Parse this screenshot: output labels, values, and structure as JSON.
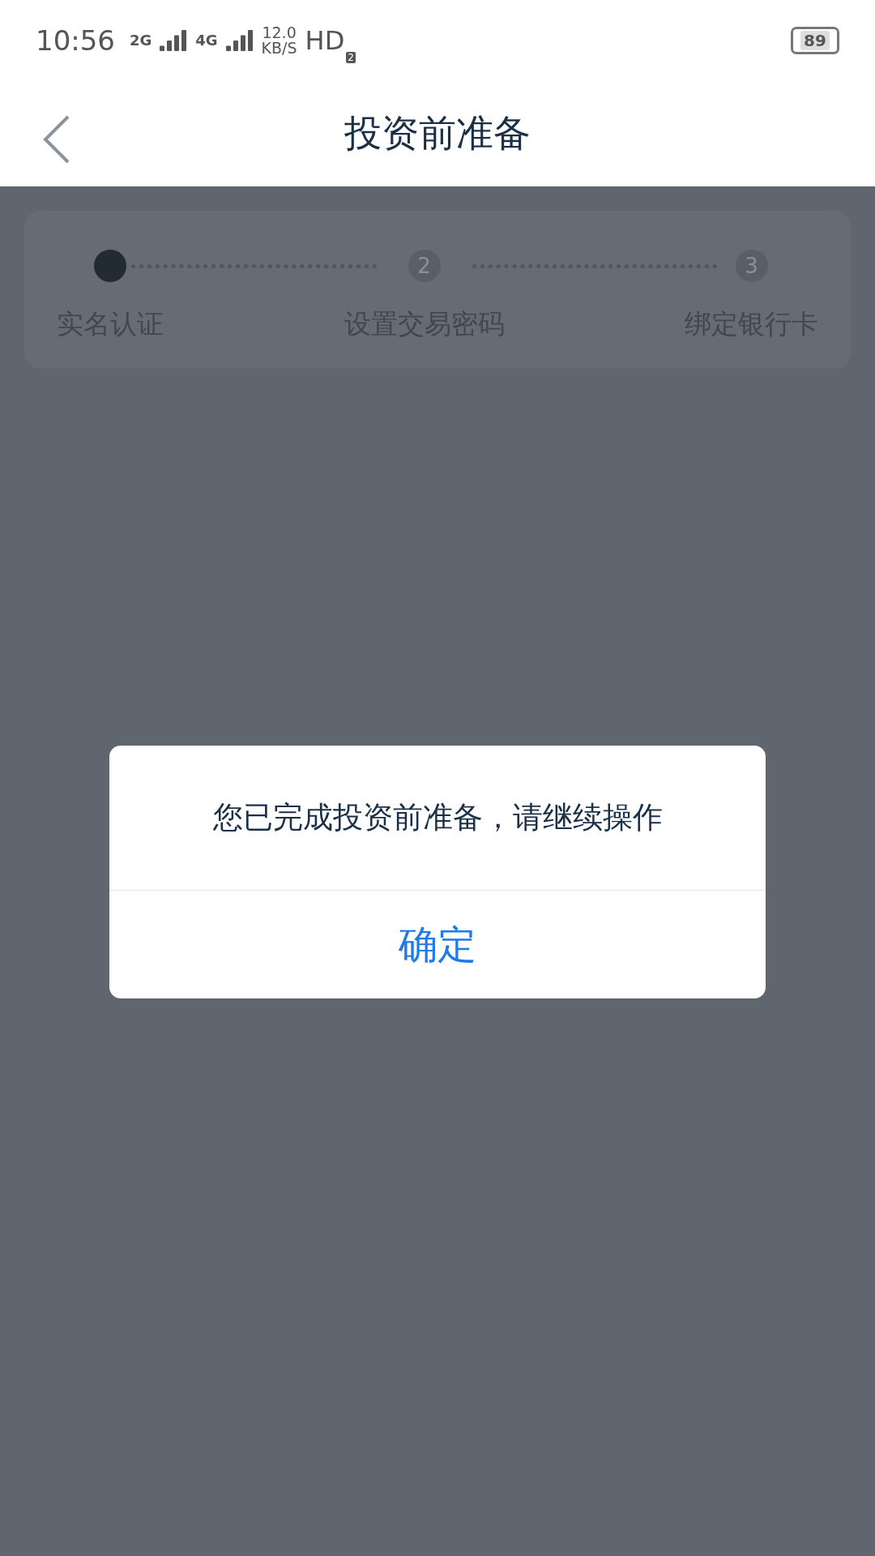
{
  "status_bar": {
    "time": "10:56",
    "sim1": "2G",
    "sim2": "4G",
    "speed": "12.0",
    "speed_unit": "KB/S",
    "hd": "HD",
    "hd_sub": "2",
    "battery": "89"
  },
  "header": {
    "title": "投资前准备"
  },
  "steps": [
    {
      "label": "实名认证",
      "selected": true
    },
    {
      "number": "2",
      "label": "设置交易密码",
      "selected": false
    },
    {
      "number": "3",
      "label": "绑定银行卡",
      "selected": false
    }
  ],
  "dialog": {
    "message": "您已完成投资前准备，请继续操作",
    "button": "确定"
  }
}
